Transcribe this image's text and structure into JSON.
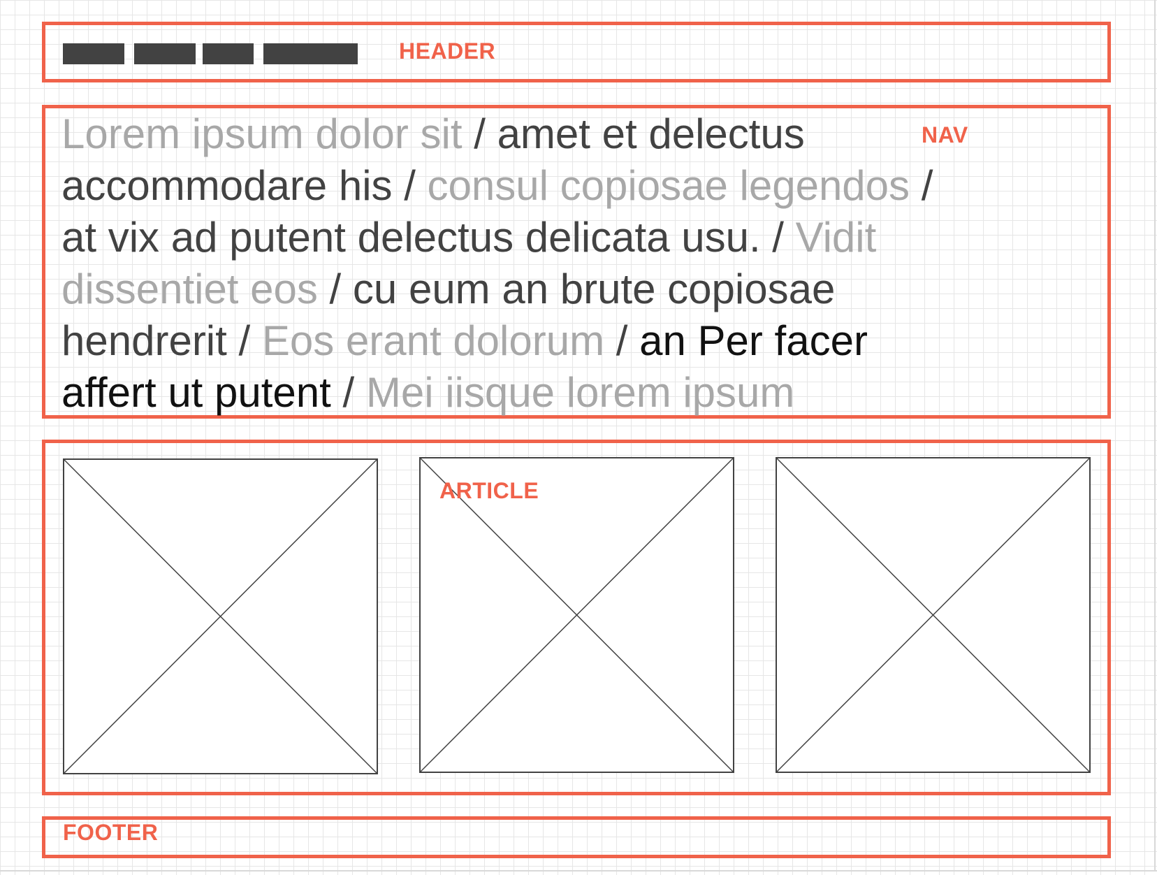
{
  "regions": {
    "header": {
      "label": "HEADER"
    },
    "nav": {
      "label": "NAV"
    },
    "article": {
      "label": "ARTICLE"
    },
    "footer": {
      "label": "FOOTER"
    }
  },
  "nav_text": [
    {
      "text": "Lorem ipsum dolor sit",
      "tone": "light"
    },
    {
      "text": " / ",
      "tone": "dark"
    },
    {
      "text": "amet et delectus accommodare his",
      "tone": "dark"
    },
    {
      "text": " / ",
      "tone": "dark"
    },
    {
      "text": "consul copiosae legendos",
      "tone": "light"
    },
    {
      "text": " / ",
      "tone": "dark"
    },
    {
      "text": "at vix ad putent delectus delicata usu.",
      "tone": "dark"
    },
    {
      "text": " / ",
      "tone": "dark"
    },
    {
      "text": "Vidit dissentiet eos",
      "tone": "light"
    },
    {
      "text": " / ",
      "tone": "dark"
    },
    {
      "text": "cu eum an brute copiosae hendrerit",
      "tone": "dark"
    },
    {
      "text": " / ",
      "tone": "dark"
    },
    {
      "text": "Eos erant dolorum",
      "tone": "light"
    },
    {
      "text": " / ",
      "tone": "dark"
    },
    {
      "text": "an Per facer affert ut putent",
      "tone": "black"
    },
    {
      "text": " / ",
      "tone": "dark"
    },
    {
      "text": "Mei iisque lorem ipsum",
      "tone": "light"
    }
  ],
  "colors": {
    "accent": "#f0624a",
    "dark": "#424242",
    "light": "#a8a8a8",
    "black": "#111111"
  },
  "article_images": [
    {
      "icon": "image-placeholder-icon"
    },
    {
      "icon": "image-placeholder-icon"
    },
    {
      "icon": "image-placeholder-icon"
    }
  ]
}
